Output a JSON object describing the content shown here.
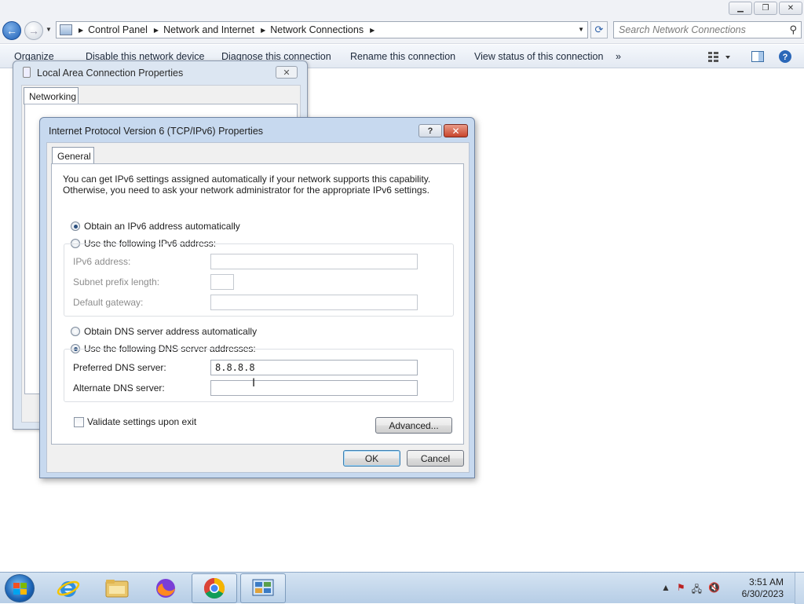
{
  "explorer": {
    "caption_buttons": [
      "minimize",
      "restore",
      "close"
    ],
    "breadcrumb": [
      "Control Panel",
      "Network and Internet",
      "Network Connections"
    ],
    "search_placeholder": "Search Network Connections",
    "commands": [
      "Organize",
      "Disable this network device",
      "Diagnose this connection",
      "Rename this connection",
      "View status of this connection",
      "»"
    ]
  },
  "lan_dialog": {
    "title": "Local Area Connection Properties",
    "tab": "Networking",
    "close_label": "✕"
  },
  "ipv6_dialog": {
    "title": "Internet Protocol Version 6 (TCP/IPv6) Properties",
    "help_label": "?",
    "close_label": "✕",
    "tab": "General",
    "description": "You can get IPv6 settings assigned automatically if your network supports this capability. Otherwise, you need to ask your network administrator for the appropriate IPv6 settings.",
    "radio_auto_ip": "Obtain an IPv6 address automatically",
    "radio_manual_ip": "Use the following IPv6 address:",
    "ipv6_address_label": "IPv6 address:",
    "subnet_label": "Subnet prefix length:",
    "gateway_label": "Default gateway:",
    "ipv6_address_value": "",
    "subnet_value": "",
    "gateway_value": "",
    "radio_auto_dns": "Obtain DNS server address automatically",
    "radio_manual_dns": "Use the following DNS server addresses:",
    "preferred_dns_label": "Preferred DNS server:",
    "alternate_dns_label": "Alternate DNS server:",
    "preferred_dns_value": "8.8.8.8",
    "alternate_dns_value": "",
    "validate_label": "Validate settings upon exit",
    "advanced_label": "Advanced...",
    "ok_label": "OK",
    "cancel_label": "Cancel",
    "selected_ip_mode": "auto",
    "selected_dns_mode": "manual",
    "validate_checked": false
  },
  "taskbar": {
    "pinned": [
      "start-button",
      "internet-explorer",
      "file-explorer",
      "firefox",
      "chrome",
      "network-connections"
    ],
    "time": "3:51 AM",
    "date": "6/30/2023"
  }
}
